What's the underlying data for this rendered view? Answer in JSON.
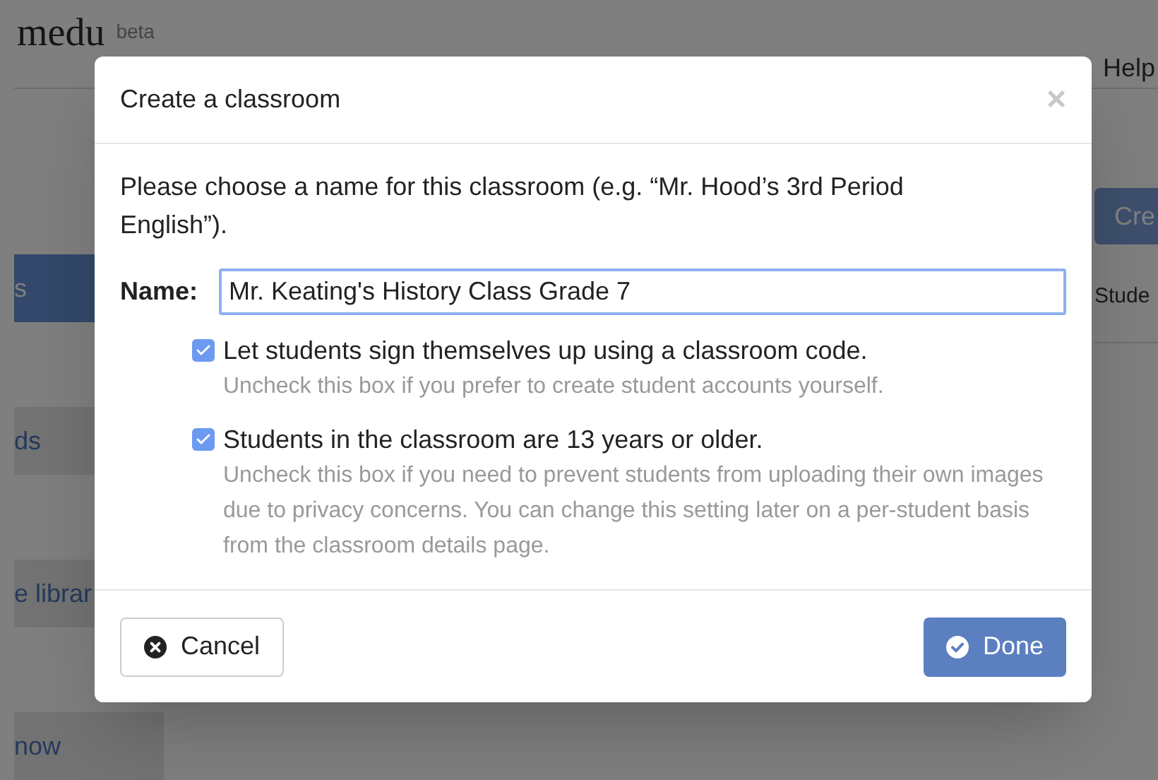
{
  "background": {
    "logo": "medu",
    "logo_badge": "beta",
    "help_link": "Help",
    "sidebar_items": [
      {
        "label": "s",
        "selected": true
      },
      {
        "label": "ds",
        "selected": false
      },
      {
        "label": "e librar",
        "selected": false
      },
      {
        "label": "now",
        "selected": false
      }
    ],
    "create_button": "Cre",
    "column_heading": "Stude"
  },
  "dialog": {
    "title": "Create a classroom",
    "close": "×",
    "intro": "Please choose a name for this classroom (e.g. “Mr. Hood’s 3rd Period English”).",
    "name_label": "Name:",
    "name_value": "Mr. Keating's History Class Grade 7",
    "options": [
      {
        "label": "Let students sign themselves up using a classroom code.",
        "help": "Uncheck this box if you prefer to create student accounts yourself.",
        "checked": true
      },
      {
        "label": "Students in the classroom are 13 years or older.",
        "help": "Uncheck this box if you need to prevent students from uploading their own images due to privacy concerns. You can change this setting later on a per-student basis from the classroom details page.",
        "checked": true
      }
    ],
    "buttons": [
      {
        "label": "Cancel",
        "kind": "cancel"
      },
      {
        "label": "Done",
        "kind": "primary"
      }
    ]
  }
}
